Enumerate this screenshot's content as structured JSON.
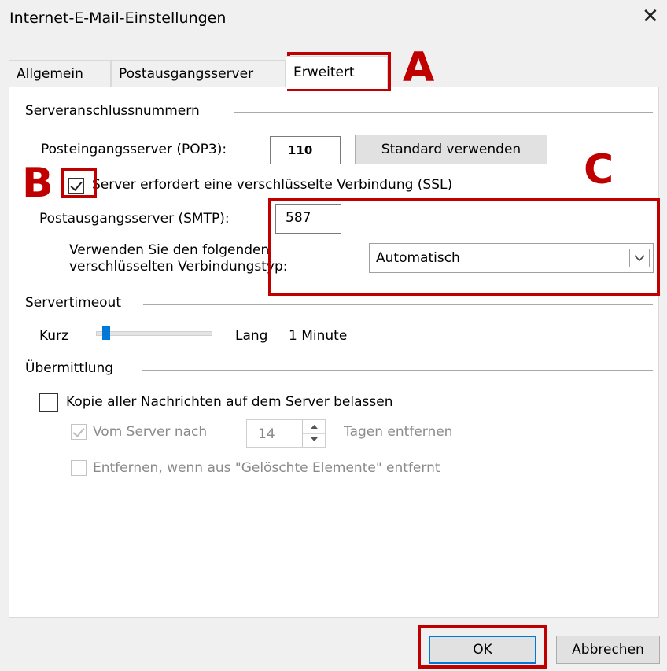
{
  "window": {
    "title": "Internet-E-Mail-Einstellungen",
    "close_glyph": "✕"
  },
  "tabs": [
    {
      "label": "Allgemein",
      "active": false
    },
    {
      "label": "Postausgangsserver",
      "active": false
    },
    {
      "label": "Erweitert",
      "active": true
    }
  ],
  "ports": {
    "section_title": "Serveranschlussnummern",
    "pop3_label": "Posteingangsserver (POP3):",
    "pop3_value": "110",
    "default_button": "Standard verwenden",
    "ssl_checkbox_label": "Server erfordert eine verschlüsselte Verbindung (SSL)",
    "ssl_checked": true,
    "smtp_label": "Postausgangsserver (SMTP):",
    "smtp_value": "587",
    "encryption_label_line1": "Verwenden Sie den folgenden",
    "encryption_label_line2": "verschlüsselten Verbindungstyp:",
    "encryption_value": "Automatisch"
  },
  "timeout": {
    "section_title": "Servertimeout",
    "short_label": "Kurz",
    "long_label": "Lang",
    "value_label": "1 Minute",
    "slider_fraction": 0.06
  },
  "delivery": {
    "section_title": "Übermittlung",
    "leave_copy_label": "Kopie aller Nachrichten auf dem Server belassen",
    "leave_copy_checked": false,
    "remove_after_label": "Vom Server nach",
    "remove_after_checked": true,
    "days_value": "14",
    "days_suffix": "Tagen entfernen",
    "remove_deleted_label": "Entfernen, wenn aus \"Gelöschte Elemente\" entfernt",
    "remove_deleted_checked": false
  },
  "footer": {
    "ok_label": "OK",
    "cancel_label": "Abbrechen"
  },
  "annotations": {
    "a": "A",
    "b": "B",
    "c": "C"
  },
  "colors": {
    "annotation": "#c00000",
    "ok_focus": "#0078d7"
  }
}
